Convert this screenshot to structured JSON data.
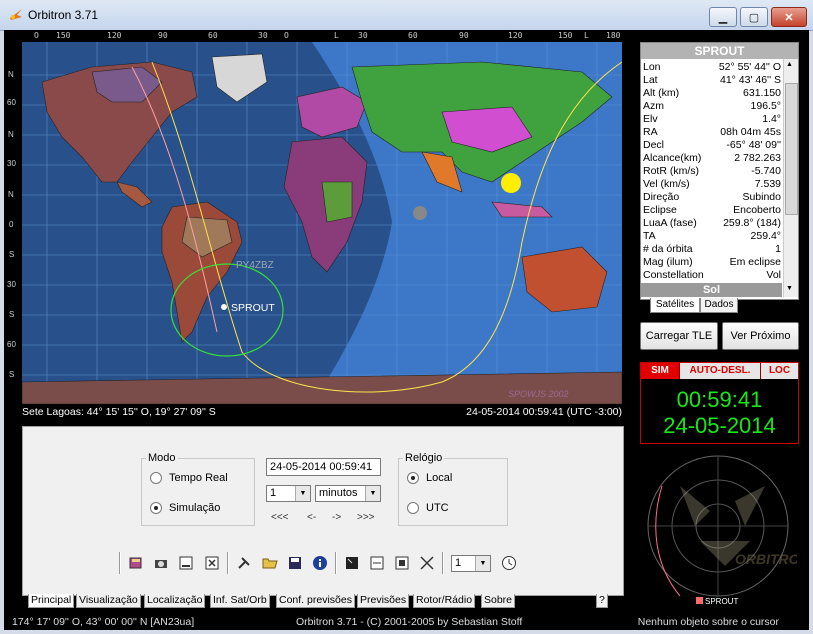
{
  "window": {
    "title": "Orbitron 3.71"
  },
  "map": {
    "top_scale": [
      "O",
      "150",
      "120",
      "90",
      "60",
      "30",
      "O",
      "L",
      "30",
      "60",
      "90",
      "120",
      "150",
      "L",
      "180"
    ],
    "left_scale": [
      "N",
      "60",
      "N",
      "30",
      "N",
      "0",
      "S",
      "30",
      "S",
      "60",
      "S"
    ],
    "labels": {
      "station": "PY4ZBZ",
      "satellite": "SPROUT",
      "credit": "SPOWJS 2002"
    },
    "status_left": "Sete Lagoas: 44° 15' 15'' O, 19° 27' 09'' S",
    "status_right": "24-05-2014 00:59:41 (UTC -3:00)"
  },
  "sat_panel": {
    "title": "SPROUT",
    "rows": [
      {
        "k": "Lon",
        "v": "52° 55' 44'' O"
      },
      {
        "k": "Lat",
        "v": "41° 43' 46'' S"
      },
      {
        "k": "Alt (km)",
        "v": "631.150"
      },
      {
        "k": "Azm",
        "v": "196.5°"
      },
      {
        "k": "Elv",
        "v": "1.4°"
      },
      {
        "k": "RA",
        "v": "08h 04m 45s"
      },
      {
        "k": "Decl",
        "v": "-65° 48' 09''"
      },
      {
        "k": "Alcance(km)",
        "v": "2 782.263"
      },
      {
        "k": "RotR (km/s)",
        "v": "-5.740"
      },
      {
        "k": "Vel (km/s)",
        "v": "7.539"
      },
      {
        "k": "Direção",
        "v": "Subindo"
      },
      {
        "k": "Eclipse",
        "v": "Encoberto"
      },
      {
        "k": "LuaA (fase)",
        "v": "259.8° (184)"
      },
      {
        "k": "TA",
        "v": "259.4°"
      },
      {
        "k": "# da órbita",
        "v": "1"
      },
      {
        "k": "Mag (ilum)",
        "v": "Em eclipse"
      },
      {
        "k": "Constellation",
        "v": "Vol"
      }
    ],
    "footer": "Sol",
    "tabs": [
      "Satélites",
      "Dados"
    ]
  },
  "buttons": {
    "load_tle": "Carregar TLE",
    "next": "Ver Próximo"
  },
  "clock": {
    "flags": [
      "SIM",
      "AUTO-DESL.",
      "LOC"
    ],
    "time": "00:59:41",
    "date": "24-05-2014"
  },
  "radar": {
    "label": "SPROUT"
  },
  "control": {
    "mode_legend": "Modo",
    "mode_real": "Tempo Real",
    "mode_sim": "Simulação",
    "datetime": "24-05-2014 00:59:41",
    "step_value": "1",
    "step_unit": "minutos",
    "nav": [
      "<<<",
      "<-",
      "->",
      ">>>"
    ],
    "clock_legend": "Relógio",
    "clock_local": "Local",
    "clock_utc": "UTC",
    "toolbar_combo": "1"
  },
  "tabs": [
    "Principal",
    "Visualização",
    "Localização",
    "Inf. Sat/Orb",
    "Conf. previsões",
    "Previsões",
    "Rotor/Rádio",
    "Sobre",
    "?"
  ],
  "status": {
    "left": "174° 17' 09'' O, 43° 00' 00'' N [AN23ua]",
    "center": "Orbitron 3.71 - (C) 2001-2005 by Sebastian Stoff",
    "right": "Nenhum objeto sobre o cursor"
  }
}
